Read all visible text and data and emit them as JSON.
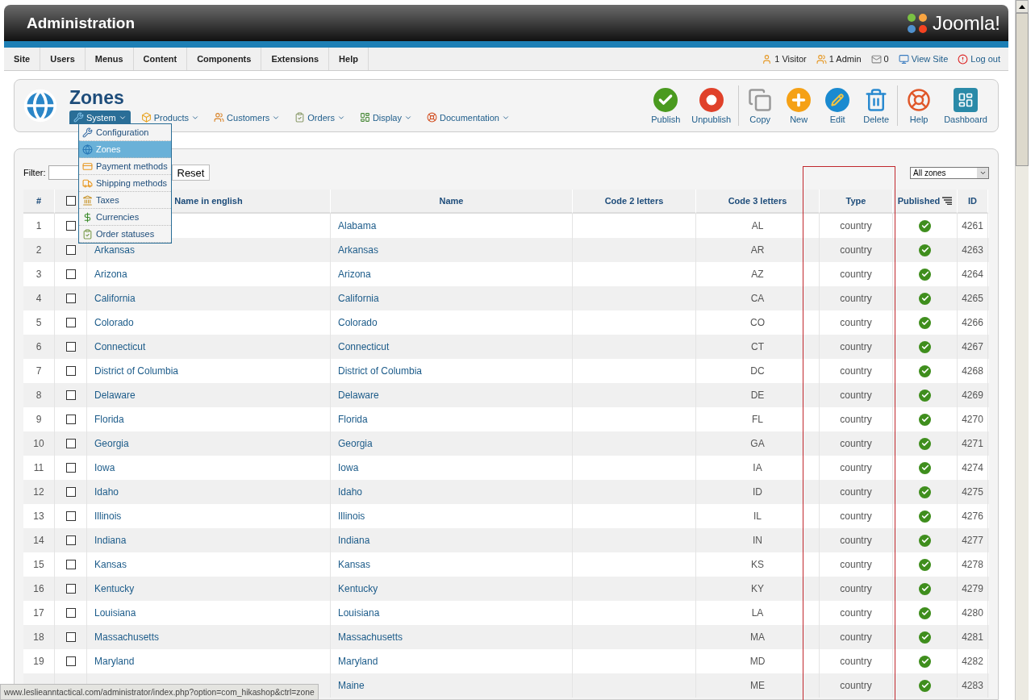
{
  "header": {
    "title": "Administration",
    "logo": "Joomla!"
  },
  "menu": [
    "Site",
    "Users",
    "Menus",
    "Content",
    "Components",
    "Extensions",
    "Help"
  ],
  "status": [
    {
      "kind": "visitor",
      "label": "1 Visitor"
    },
    {
      "kind": "admin",
      "label": "1 Admin"
    },
    {
      "kind": "messages",
      "label": "0"
    },
    {
      "kind": "view",
      "label": "View Site"
    },
    {
      "kind": "logout",
      "label": "Log out"
    }
  ],
  "page": {
    "title": "Zones"
  },
  "submenu": [
    {
      "kind": "system",
      "label": "System",
      "selected": true
    },
    {
      "kind": "products",
      "label": "Products",
      "selected": false
    },
    {
      "kind": "customers",
      "label": "Customers",
      "selected": false
    },
    {
      "kind": "orders",
      "label": "Orders",
      "selected": false
    },
    {
      "kind": "display",
      "label": "Display",
      "selected": false
    },
    {
      "kind": "documentation",
      "label": "Documentation",
      "selected": false
    }
  ],
  "dropdown": [
    {
      "kind": "config",
      "label": "Configuration",
      "selected": false
    },
    {
      "kind": "zones",
      "label": "Zones",
      "selected": true
    },
    {
      "kind": "payment",
      "label": "Payment methods",
      "selected": false
    },
    {
      "kind": "shipping",
      "label": "Shipping methods",
      "selected": false
    },
    {
      "kind": "taxes",
      "label": "Taxes",
      "selected": false
    },
    {
      "kind": "currencies",
      "label": "Currencies",
      "selected": false
    },
    {
      "kind": "statuses",
      "label": "Order statuses",
      "selected": false
    }
  ],
  "toolbar": [
    {
      "kind": "publish",
      "label": "Publish"
    },
    {
      "kind": "unpublish",
      "label": "Unpublish"
    },
    {
      "kind": "sep"
    },
    {
      "kind": "copy",
      "label": "Copy"
    },
    {
      "kind": "new",
      "label": "New"
    },
    {
      "kind": "edit",
      "label": "Edit"
    },
    {
      "kind": "delete",
      "label": "Delete"
    },
    {
      "kind": "sep"
    },
    {
      "kind": "help",
      "label": "Help"
    },
    {
      "kind": "dashboard",
      "label": "Dashboard"
    }
  ],
  "filter": {
    "label": "Filter:",
    "reset": "Reset",
    "select": "All zones"
  },
  "table": {
    "select_all_checked": false,
    "columns": [
      "#",
      "Name in english",
      "Name",
      "Code 2 letters",
      "Code 3 letters",
      "Type",
      "Published",
      "ID"
    ],
    "rows": [
      {
        "num": "1",
        "checked": false,
        "name": "Alabama",
        "code3": "AL",
        "type": "country",
        "published": true,
        "id": "4261"
      },
      {
        "num": "2",
        "checked": false,
        "name_en": "Arkansas",
        "name": "Arkansas",
        "code3": "AR",
        "type": "country",
        "published": true,
        "id": "4263"
      },
      {
        "num": "3",
        "checked": false,
        "name_en": "Arizona",
        "name": "Arizona",
        "code3": "AZ",
        "type": "country",
        "published": true,
        "id": "4264"
      },
      {
        "num": "4",
        "checked": false,
        "name_en": "California",
        "name": "California",
        "code3": "CA",
        "type": "country",
        "published": true,
        "id": "4265"
      },
      {
        "num": "5",
        "checked": false,
        "name_en": "Colorado",
        "name": "Colorado",
        "code3": "CO",
        "type": "country",
        "published": true,
        "id": "4266"
      },
      {
        "num": "6",
        "checked": false,
        "name_en": "Connecticut",
        "name": "Connecticut",
        "code3": "CT",
        "type": "country",
        "published": true,
        "id": "4267"
      },
      {
        "num": "7",
        "checked": false,
        "name_en": "District of Columbia",
        "name": "District of Columbia",
        "code3": "DC",
        "type": "country",
        "published": true,
        "id": "4268"
      },
      {
        "num": "8",
        "checked": false,
        "name_en": "Delaware",
        "name": "Delaware",
        "code3": "DE",
        "type": "country",
        "published": true,
        "id": "4269"
      },
      {
        "num": "9",
        "checked": false,
        "name_en": "Florida",
        "name": "Florida",
        "code3": "FL",
        "type": "country",
        "published": true,
        "id": "4270"
      },
      {
        "num": "10",
        "checked": false,
        "name_en": "Georgia",
        "name": "Georgia",
        "code3": "GA",
        "type": "country",
        "published": true,
        "id": "4271"
      },
      {
        "num": "11",
        "checked": false,
        "name_en": "Iowa",
        "name": "Iowa",
        "code3": "IA",
        "type": "country",
        "published": true,
        "id": "4274"
      },
      {
        "num": "12",
        "checked": false,
        "name_en": "Idaho",
        "name": "Idaho",
        "code3": "ID",
        "type": "country",
        "published": true,
        "id": "4275"
      },
      {
        "num": "13",
        "checked": false,
        "name_en": "Illinois",
        "name": "Illinois",
        "code3": "IL",
        "type": "country",
        "published": true,
        "id": "4276"
      },
      {
        "num": "14",
        "checked": false,
        "name_en": "Indiana",
        "name": "Indiana",
        "code3": "IN",
        "type": "country",
        "published": true,
        "id": "4277"
      },
      {
        "num": "15",
        "checked": false,
        "name_en": "Kansas",
        "name": "Kansas",
        "code3": "KS",
        "type": "country",
        "published": true,
        "id": "4278"
      },
      {
        "num": "16",
        "checked": false,
        "name_en": "Kentucky",
        "name": "Kentucky",
        "code3": "KY",
        "type": "country",
        "published": true,
        "id": "4279"
      },
      {
        "num": "17",
        "checked": false,
        "name_en": "Louisiana",
        "name": "Louisiana",
        "code3": "LA",
        "type": "country",
        "published": true,
        "id": "4280"
      },
      {
        "num": "18",
        "checked": false,
        "name_en": "Massachusetts",
        "name": "Massachusetts",
        "code3": "MA",
        "type": "country",
        "published": true,
        "id": "4281"
      },
      {
        "num": "19",
        "checked": false,
        "name_en": "Maryland",
        "name": "Maryland",
        "code3": "MD",
        "type": "country",
        "published": true,
        "id": "4282"
      },
      {
        "name": "Maine",
        "code3": "ME",
        "type": "country",
        "published": true,
        "id": "4283"
      }
    ]
  },
  "status_bar": "www.leslieanntactical.com/administrator/index.php?option=com_hikashop&ctrl=zone"
}
